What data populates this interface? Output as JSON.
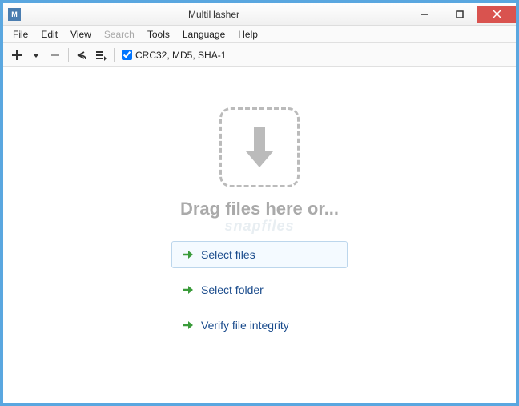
{
  "window": {
    "title": "MultiHasher",
    "app_icon_letter": "M"
  },
  "menubar": {
    "file": "File",
    "edit": "Edit",
    "view": "View",
    "search": "Search",
    "tools": "Tools",
    "language": "Language",
    "help": "Help"
  },
  "toolbar": {
    "hash_label": "CRC32, MD5, SHA-1",
    "hash_checked": true
  },
  "content": {
    "drag_text": "Drag files here or...",
    "watermark": "snapfiles",
    "actions": {
      "select_files": "Select files",
      "select_folder": "Select folder",
      "verify": "Verify file integrity"
    }
  }
}
